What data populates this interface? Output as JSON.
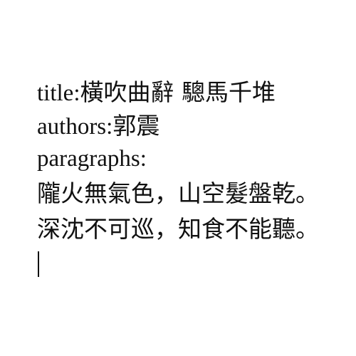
{
  "document": {
    "title_label": "title:",
    "title_value": "橫吹曲辭 驄馬千堆",
    "authors_label": "authors:",
    "authors_value": "郭震",
    "paragraphs_label": "paragraphs:",
    "paragraphs": [
      "隴火無氣色，山空髮盤乾。",
      "深沈不可巡，知食不能聽。"
    ]
  }
}
